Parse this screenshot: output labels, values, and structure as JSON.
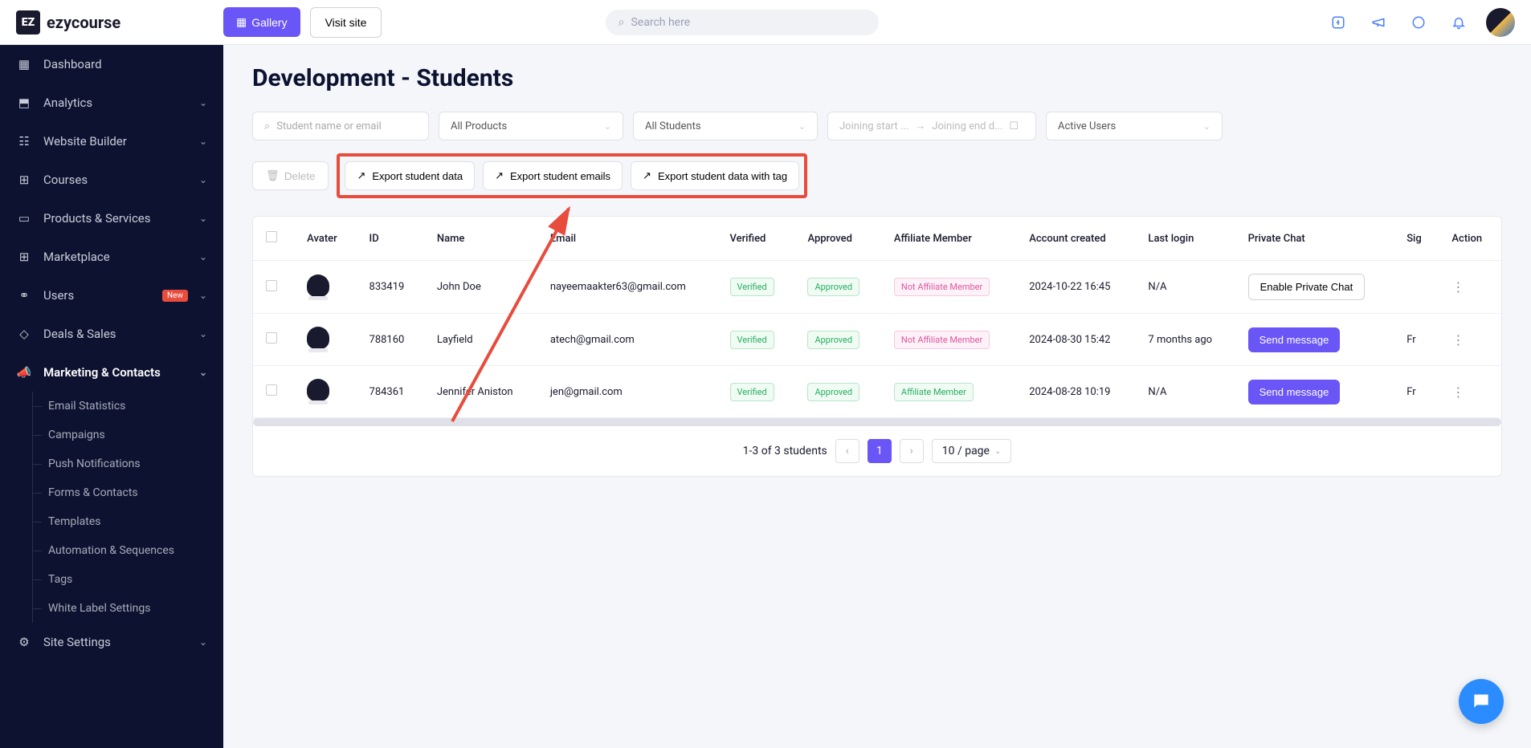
{
  "brand": "ezycourse",
  "topbar": {
    "gallery_label": "Gallery",
    "visit_label": "Visit site",
    "search_placeholder": "Search here"
  },
  "sidebar": {
    "items": [
      {
        "label": "Dashboard",
        "icon": "dashboard-icon",
        "expandable": false
      },
      {
        "label": "Analytics",
        "icon": "analytics-icon",
        "expandable": true
      },
      {
        "label": "Website Builder",
        "icon": "website-icon",
        "expandable": true
      },
      {
        "label": "Courses",
        "icon": "courses-icon",
        "expandable": true
      },
      {
        "label": "Products & Services",
        "icon": "products-icon",
        "expandable": true
      },
      {
        "label": "Marketplace",
        "icon": "marketplace-icon",
        "expandable": true
      },
      {
        "label": "Users",
        "icon": "users-icon",
        "expandable": true,
        "badge": "New"
      },
      {
        "label": "Deals & Sales",
        "icon": "deals-icon",
        "expandable": true
      },
      {
        "label": "Marketing & Contacts",
        "icon": "marketing-icon",
        "expandable": true,
        "active": true
      },
      {
        "label": "Site Settings",
        "icon": "settings-icon",
        "expandable": true
      }
    ],
    "marketing_sub": [
      "Email Statistics",
      "Campaigns",
      "Push Notifications",
      "Forms & Contacts",
      "Templates",
      "Automation & Sequences",
      "Tags",
      "White Label Settings"
    ]
  },
  "page": {
    "title": "Development - Students"
  },
  "filters": {
    "search_placeholder": "Student name or email",
    "products": "All Products",
    "students": "All Students",
    "date_start": "Joining start ...",
    "date_end": "Joining end d...",
    "status": "Active Users"
  },
  "actions": {
    "delete": "Delete",
    "export1": "Export student data",
    "export2": "Export student emails",
    "export3": "Export student data with tag"
  },
  "table": {
    "headers": [
      "Avater",
      "ID",
      "Name",
      "Email",
      "Verified",
      "Approved",
      "Affiliate Member",
      "Account created",
      "Last login",
      "Private Chat",
      "Sig",
      "Action"
    ],
    "rows": [
      {
        "id": "833419",
        "name": "John Doe",
        "email": "nayeemaakter63@gmail.com",
        "verified": "Verified",
        "approved": "Approved",
        "affiliate": "Not Affiliate Member",
        "affiliate_type": "pink",
        "created": "2024-10-22 16:45",
        "login": "N/A",
        "chat_label": "Enable Private Chat",
        "chat_style": "outline",
        "sig": ""
      },
      {
        "id": "788160",
        "name": "Layfield",
        "email": "atech@gmail.com",
        "verified": "Verified",
        "approved": "Approved",
        "affiliate": "Not Affiliate Member",
        "affiliate_type": "pink",
        "created": "2024-08-30 15:42",
        "login": "7 months ago",
        "chat_label": "Send message",
        "chat_style": "primary",
        "sig": "Fr"
      },
      {
        "id": "784361",
        "name": "Jennifer Aniston",
        "email": "jen@gmail.com",
        "verified": "Verified",
        "approved": "Approved",
        "affiliate": "Affiliate Member",
        "affiliate_type": "ggreen",
        "created": "2024-08-28 10:19",
        "login": "N/A",
        "chat_label": "Send message",
        "chat_style": "primary",
        "sig": "Fr"
      }
    ]
  },
  "pagination": {
    "summary": "1-3 of 3 students",
    "current": "1",
    "per_page": "10 / page"
  }
}
